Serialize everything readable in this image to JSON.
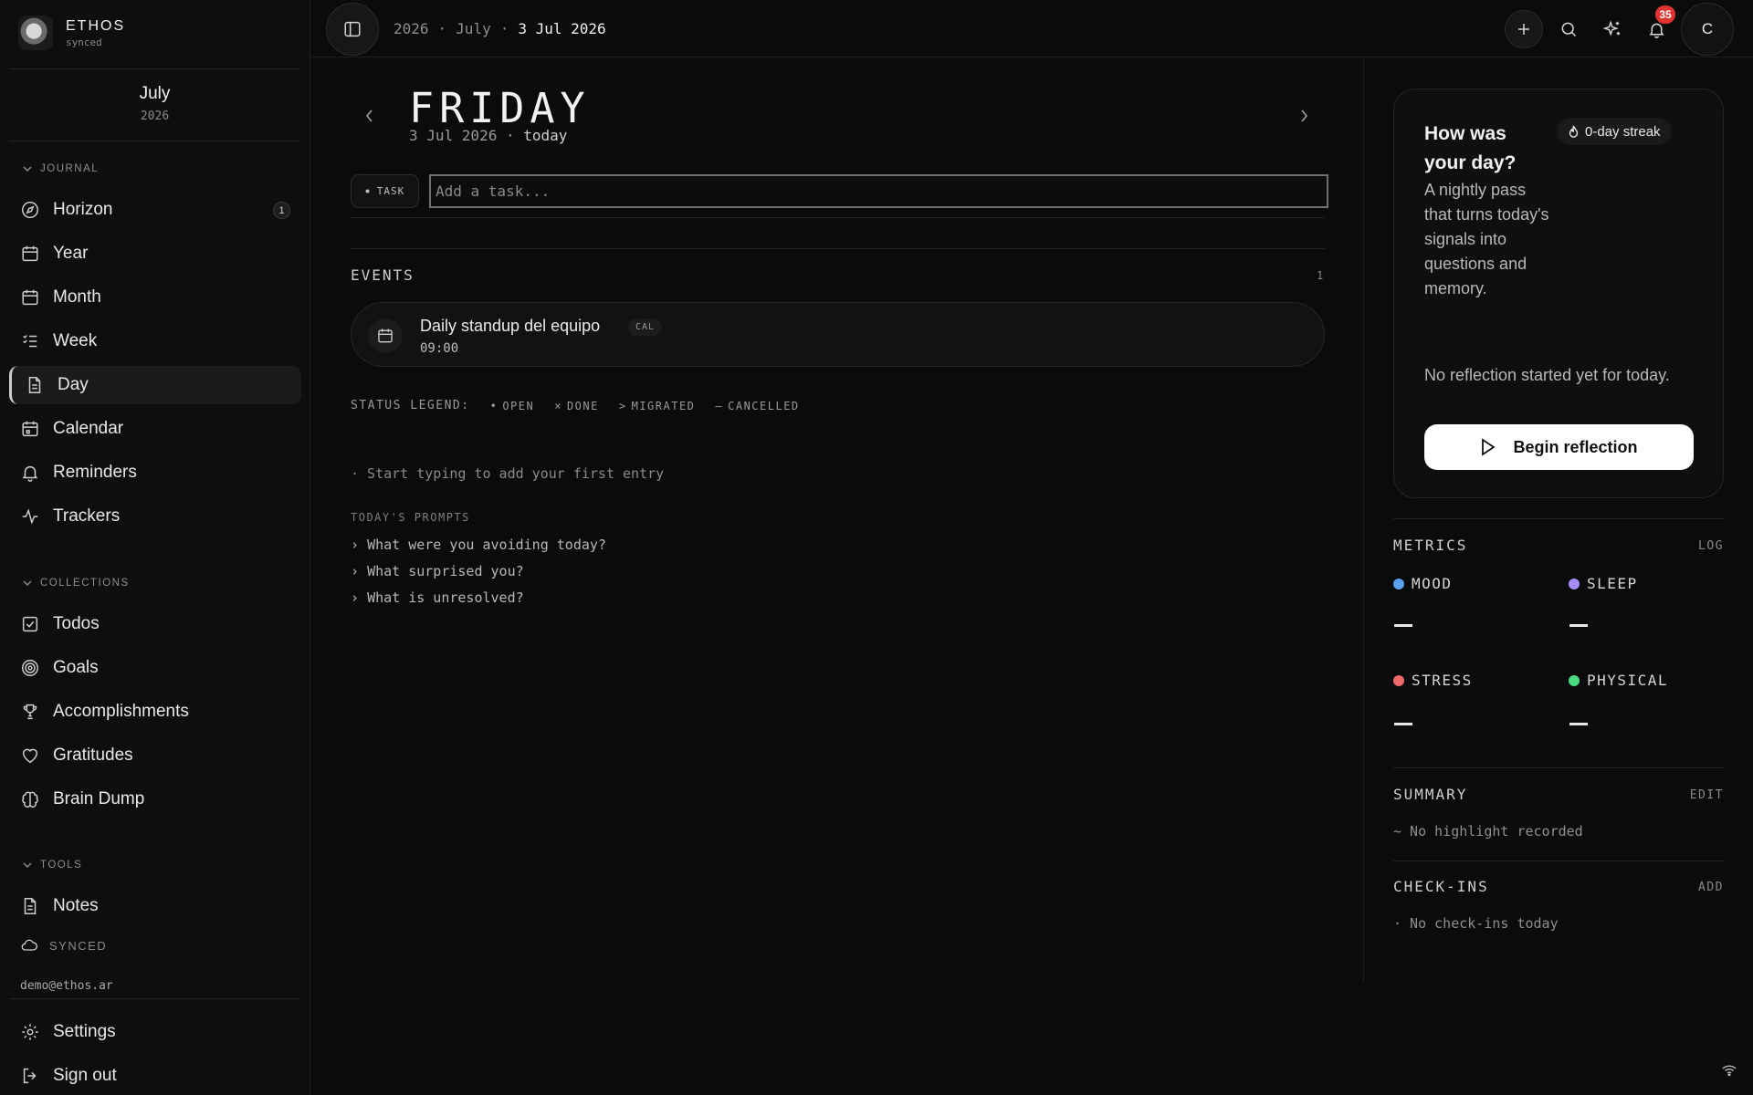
{
  "brand": {
    "name": "ETHOS",
    "status": "synced"
  },
  "sidebar": {
    "month": "July",
    "year": "2026",
    "journal_header": "JOURNAL",
    "journal_items": [
      {
        "label": "Horizon",
        "icon": "compass-icon",
        "badge": "1"
      },
      {
        "label": "Year",
        "icon": "calendar-icon"
      },
      {
        "label": "Month",
        "icon": "calendar-grid-icon"
      },
      {
        "label": "Week",
        "icon": "list-icon"
      },
      {
        "label": "Day",
        "icon": "page-icon",
        "active": true
      },
      {
        "label": "Calendar",
        "icon": "calendar-dates-icon"
      },
      {
        "label": "Reminders",
        "icon": "bell-icon"
      },
      {
        "label": "Trackers",
        "icon": "activity-icon"
      }
    ],
    "collections_header": "COLLECTIONS",
    "collection_items": [
      {
        "label": "Todos",
        "icon": "checkbox-icon"
      },
      {
        "label": "Goals",
        "icon": "target-icon"
      },
      {
        "label": "Accomplishments",
        "icon": "trophy-icon"
      },
      {
        "label": "Gratitudes",
        "icon": "heart-icon"
      },
      {
        "label": "Brain Dump",
        "icon": "brain-icon"
      }
    ],
    "tools_header": "TOOLS",
    "tool_items": [
      {
        "label": "Notes",
        "icon": "page-icon"
      }
    ],
    "sync_label": "SYNCED",
    "email": "demo@ethos.ar",
    "settings_label": "Settings",
    "signout_label": "Sign out"
  },
  "topbar": {
    "crumbs": [
      "2026",
      "·",
      "July",
      "·",
      "3 Jul 2026"
    ],
    "notifications": "35",
    "avatar_initial": "C"
  },
  "day": {
    "title": "FRIDAY",
    "date": "3 Jul 2026",
    "dot": "·",
    "today": "today",
    "task_tag": "TASK",
    "task_placeholder": "Add a task...",
    "events_header": "EVENTS",
    "events_count": "1",
    "event": {
      "title": "Daily standup del equipo",
      "tag": "CAL",
      "time": "09:00"
    },
    "legend_label": "STATUS LEGEND:",
    "legend": [
      {
        "symbol": "•",
        "label": "OPEN"
      },
      {
        "symbol": "×",
        "label": "DONE"
      },
      {
        "symbol": ">",
        "label": "MIGRATED"
      },
      {
        "symbol": "—",
        "label": "CANCELLED"
      }
    ],
    "hint": "· Start typing to add your first entry",
    "prompts_header": "TODAY'S PROMPTS",
    "prompts": [
      "What were you avoiding today?",
      "What surprised you?",
      "What is unresolved?"
    ]
  },
  "reflection": {
    "title": "How was your day?",
    "streak": "0-day streak",
    "description": "A nightly pass that turns today's signals into questions and memory.",
    "none": "No reflection started yet for today.",
    "button": "Begin reflection"
  },
  "metrics": {
    "header": "METRICS",
    "action": "LOG",
    "items": [
      {
        "label": "MOOD",
        "color": "#5aa0f2",
        "value": "—"
      },
      {
        "label": "SLEEP",
        "color": "#a78bfa",
        "value": "—"
      },
      {
        "label": "STRESS",
        "color": "#f06a6a",
        "value": "—"
      },
      {
        "label": "PHYSICAL",
        "color": "#4ade80",
        "value": "—"
      }
    ]
  },
  "summary": {
    "header": "SUMMARY",
    "action": "EDIT",
    "note": "~ No highlight recorded"
  },
  "checkins": {
    "header": "CHECK-INS",
    "action": "ADD",
    "note": "· No check-ins today"
  }
}
